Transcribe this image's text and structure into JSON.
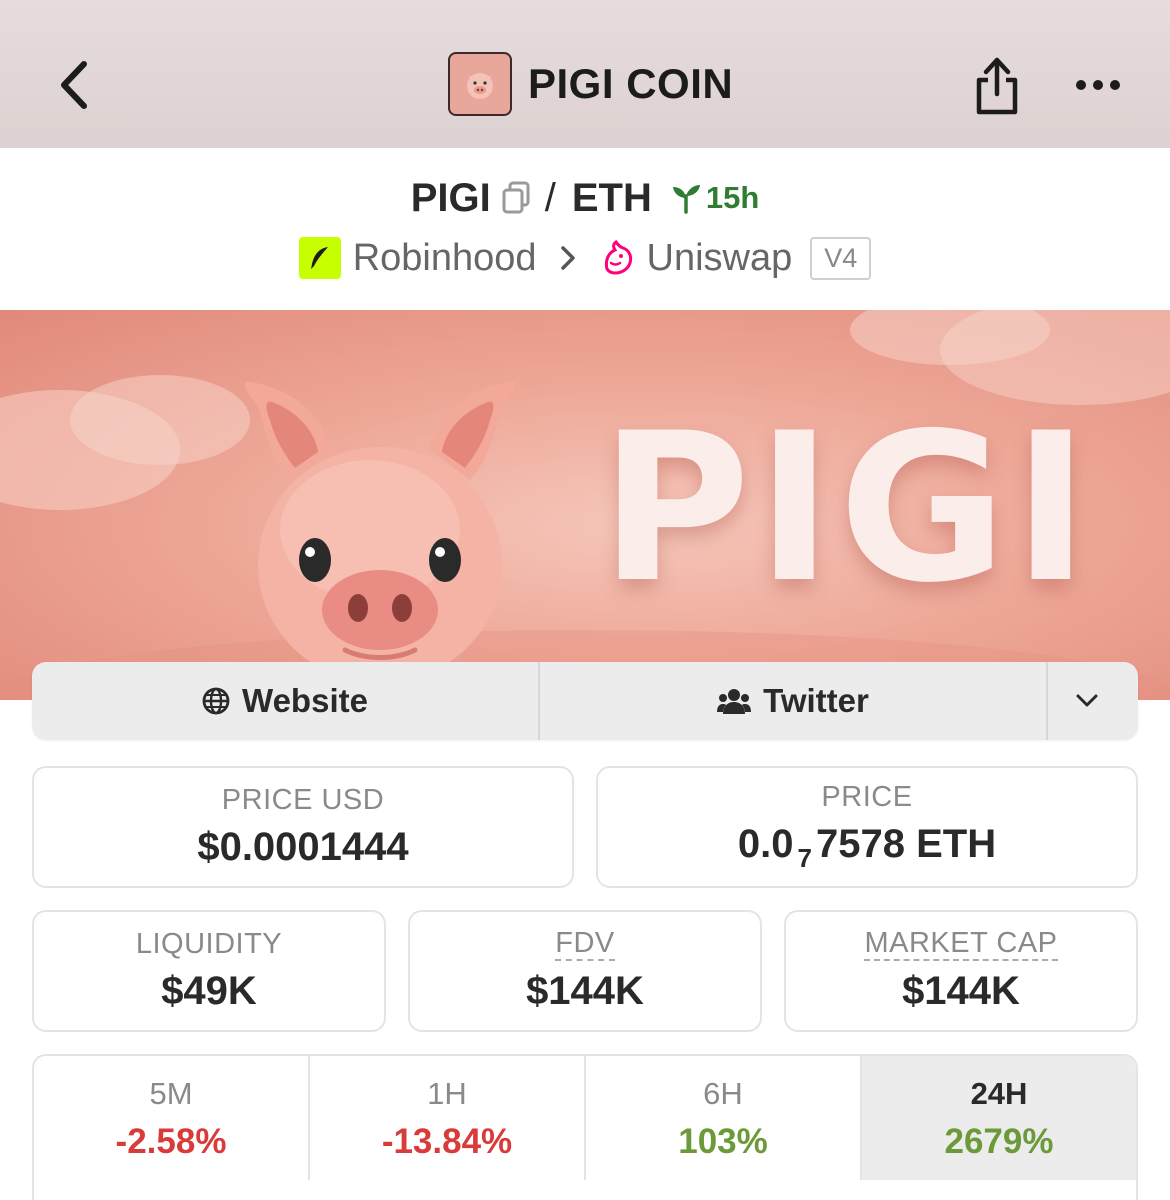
{
  "header": {
    "title": "PIGI COIN",
    "icons": {
      "back": "chevron-left-icon",
      "share": "share-icon",
      "more": "more-horizontal-icon"
    }
  },
  "pair": {
    "base": "PIGI",
    "separator": "/",
    "quote": "ETH",
    "age": "15h",
    "chain": "Robinhood",
    "dex": "Uniswap",
    "version": "V4"
  },
  "banner": {
    "text": "PIGI"
  },
  "links": {
    "website": "Website",
    "twitter": "Twitter"
  },
  "stats": {
    "price_usd": {
      "label": "PRICE USD",
      "value": "$0.0001444"
    },
    "price_eth": {
      "label": "PRICE",
      "value_prefix": "0.0",
      "value_sub": "7",
      "value_suffix": "7578 ETH"
    },
    "liquidity": {
      "label": "LIQUIDITY",
      "value": "$49K"
    },
    "fdv": {
      "label": "FDV",
      "value": "$144K"
    },
    "market_cap": {
      "label": "MARKET CAP",
      "value": "$144K"
    }
  },
  "timeframes": [
    {
      "label": "5M",
      "change": "-2.58%"
    },
    {
      "label": "1H",
      "change": "-13.84%"
    },
    {
      "label": "6H",
      "change": "103%"
    },
    {
      "label": "24H",
      "change": "2679%"
    }
  ],
  "colors": {
    "negative": "#d93a3a",
    "positive": "#6c9a3a",
    "age_badge": "#2e7d32",
    "chain_accent": "#c8ff00",
    "dex_accent": "#ff007a"
  }
}
